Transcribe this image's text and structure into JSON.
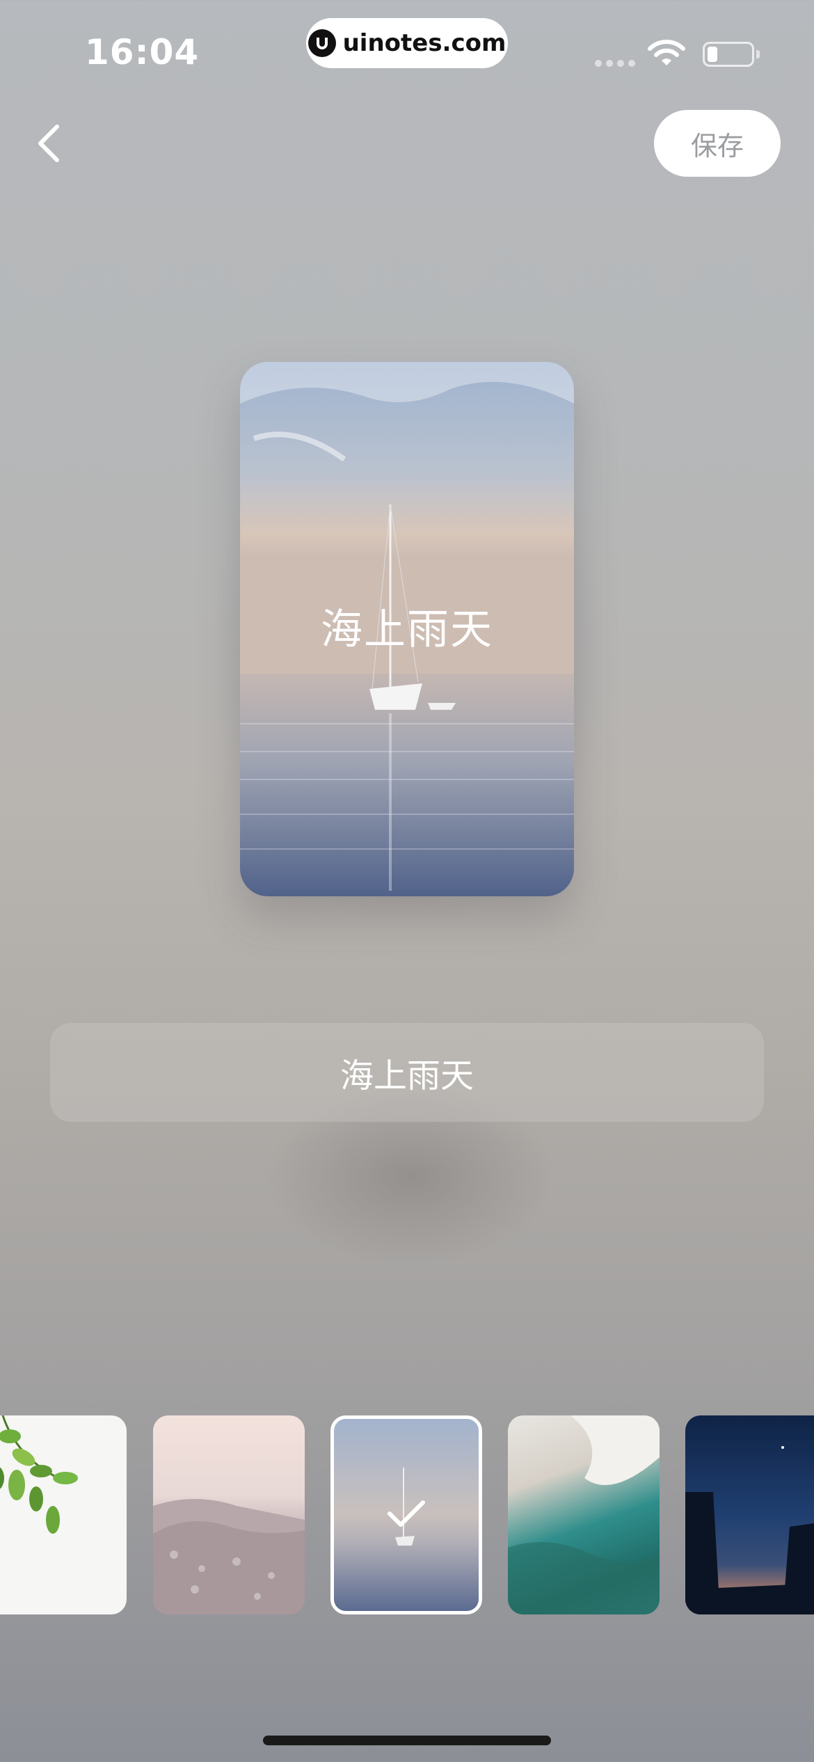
{
  "status_bar": {
    "time": "16:04",
    "url": "uinotes.com"
  },
  "nav": {
    "save_label": "保存"
  },
  "preview": {
    "title": "海上雨天"
  },
  "name_field": {
    "value": "海上雨天"
  },
  "thumbnails": [
    {
      "label": "leaves",
      "selected": false
    },
    {
      "label": "snow-mountain",
      "selected": false
    },
    {
      "label": "sailboat-sea",
      "selected": true
    },
    {
      "label": "wave",
      "selected": false
    },
    {
      "label": "night-sky",
      "selected": false
    }
  ],
  "colors": {
    "accent_white": "#ffffff",
    "save_text": "#9a9ca0"
  }
}
